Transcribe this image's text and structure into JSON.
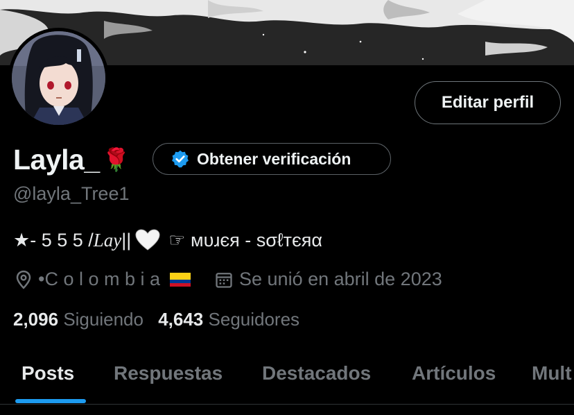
{
  "profile": {
    "display_name": "Layla_",
    "name_emoji": "🌹",
    "handle": "@layla_Tree1",
    "bio": {
      "prefix": "★- 5 5 5 / ",
      "lay": "Lay",
      "bars": " ||",
      "suffix": "☞ ᴍᴜɹєя - sσℓтєяα"
    },
    "location": "•C o l o m b i a",
    "joined": "Se unió en abril de 2023",
    "following_count": "2,096",
    "following_label": "Siguiendo",
    "followers_count": "4,643",
    "followers_label": "Seguidores"
  },
  "actions": {
    "edit_profile": "Editar perfil",
    "get_verified": "Obtener verificación"
  },
  "tabs": [
    "Posts",
    "Respuestas",
    "Destacados",
    "Artículos",
    "Mult"
  ],
  "active_tab": "Posts",
  "colors": {
    "background": "#000000",
    "text": "#e7e9ea",
    "muted": "#71767b",
    "accent": "#1d9bf0",
    "border": "#2f3336"
  },
  "icons": {
    "location": "location-pin-icon",
    "calendar": "calendar-icon",
    "verified": "verified-badge-icon",
    "heart": "white-heart-icon",
    "flag": "colombia-flag-icon"
  }
}
